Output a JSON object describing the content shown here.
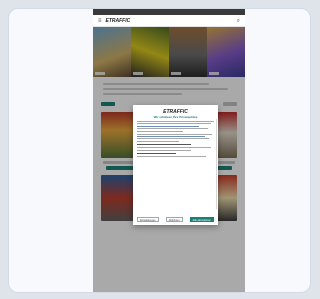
{
  "app": {
    "logo": "ETRAFFIC",
    "menu_icon": "hamburger-icon",
    "search_icon": "search-icon"
  },
  "consent_dialog": {
    "logo": "ETRAFFIC",
    "title": "Wir schätzen Ihre Privatsphäre",
    "buttons": {
      "settings": "Einstellungen",
      "reject": "Ablehnen",
      "accept": "Alle akzeptieren"
    }
  },
  "colors": {
    "accent": "#1a7f75",
    "overlay": "rgba(0,0,0,0.30)",
    "background": "#dfe3ea"
  }
}
